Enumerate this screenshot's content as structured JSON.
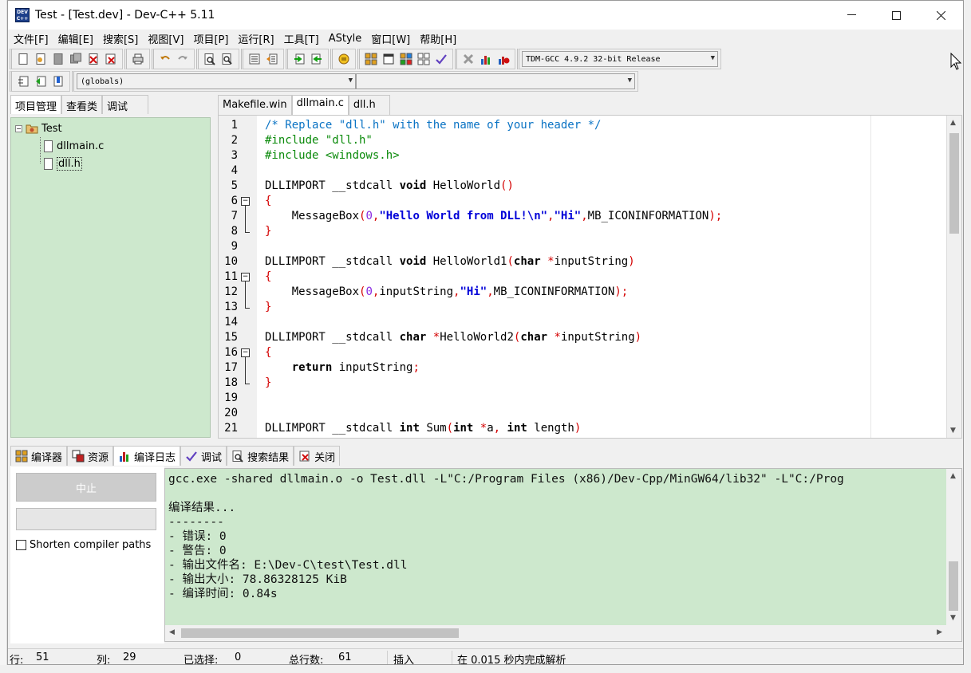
{
  "window": {
    "title": "Test - [Test.dev] - Dev-C++ 5.11",
    "logo_text": "DEV C++"
  },
  "menu": [
    "文件[F]",
    "编辑[E]",
    "搜索[S]",
    "视图[V]",
    "项目[P]",
    "运行[R]",
    "工具[T]",
    "AStyle",
    "窗口[W]",
    "帮助[H]"
  ],
  "toolbar": {
    "compiler_select": "TDM-GCC 4.9.2 32-bit Release",
    "scope_select": "(globals)",
    "function_select": ""
  },
  "project_panel": {
    "tabs": [
      "项目管理",
      "查看类",
      "调试"
    ],
    "tree": {
      "project": "Test",
      "files": [
        "dllmain.c",
        "dll.h"
      ]
    }
  },
  "editor": {
    "tabs": [
      "Makefile.win",
      "dllmain.c",
      "dll.h"
    ],
    "active_tab": "dllmain.c",
    "lines": [
      {
        "n": "1",
        "text": "/* Replace \"dll.h\" with the name of your header */"
      },
      {
        "n": "2",
        "text": "#include \"dll.h\""
      },
      {
        "n": "3",
        "text": "#include <windows.h>"
      },
      {
        "n": "4",
        "text": ""
      },
      {
        "n": "5",
        "text": "DLLIMPORT __stdcall void HelloWorld()"
      },
      {
        "n": "6",
        "text": "{"
      },
      {
        "n": "7",
        "text": "    MessageBox(0,\"Hello World from DLL!\\n\",\"Hi\",MB_ICONINFORMATION);"
      },
      {
        "n": "8",
        "text": "}"
      },
      {
        "n": "9",
        "text": ""
      },
      {
        "n": "10",
        "text": "DLLIMPORT __stdcall void HelloWorld1(char *inputString)"
      },
      {
        "n": "11",
        "text": "{"
      },
      {
        "n": "12",
        "text": "    MessageBox(0,inputString,\"Hi\",MB_ICONINFORMATION);"
      },
      {
        "n": "13",
        "text": "}"
      },
      {
        "n": "14",
        "text": ""
      },
      {
        "n": "15",
        "text": "DLLIMPORT __stdcall char *HelloWorld2(char *inputString)"
      },
      {
        "n": "16",
        "text": "{"
      },
      {
        "n": "17",
        "text": "    return inputString;"
      },
      {
        "n": "18",
        "text": "}"
      },
      {
        "n": "19",
        "text": ""
      },
      {
        "n": "20",
        "text": ""
      },
      {
        "n": "21",
        "text": "DLLIMPORT __stdcall int Sum(int *a, int length)"
      }
    ]
  },
  "bottom_panel": {
    "tabs": [
      "编译器",
      "资源",
      "编译日志",
      "调试",
      "搜索结果",
      "关闭"
    ],
    "active_tab": "编译日志",
    "stop_button": "中止",
    "shorten_paths_label": "Shorten compiler paths",
    "log_lines": [
      "gcc.exe -shared dllmain.o -o Test.dll -L\"C:/Program Files (x86)/Dev-Cpp/MinGW64/lib32\" -L\"C:/Prog",
      "",
      "编译结果...",
      "--------",
      "- 错误: 0",
      "- 警告: 0",
      "- 输出文件名: E:\\Dev-C\\test\\Test.dll",
      "- 输出大小: 78.86328125 KiB",
      "- 编译时间: 0.84s"
    ]
  },
  "status": {
    "row_label": "行:",
    "row_value": "51",
    "col_label": "列:",
    "col_value": "29",
    "sel_label": "已选择:",
    "sel_value": "0",
    "lines_label": "总行数:",
    "lines_value": "61",
    "mode": "插入",
    "parse_msg": "在 0.015 秒内完成解析"
  },
  "colors": {
    "tree_bg": "#cde8cd",
    "log_bg": "#cde8cd",
    "comment": "#0a73c4",
    "preprocessor": "#0a8a0a",
    "symbol": "#d40000",
    "string": "#0000d8"
  }
}
